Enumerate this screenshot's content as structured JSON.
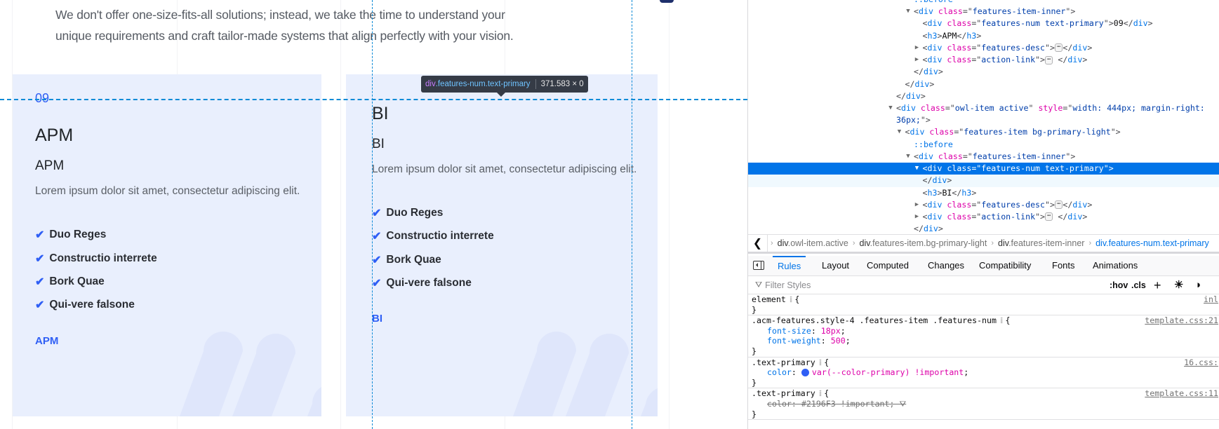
{
  "page": {
    "intro_lines": [
      "We don't offer one-size-fits-all solutions; instead, we take the time to understand your",
      "unique requirements and craft tailor-made systems that align perfectly with your vision."
    ],
    "cards": [
      {
        "num": "09",
        "title": "APM",
        "subtitle": "APM",
        "desc": "Lorem ipsum dolor sit amet, consectetur adipiscing elit.",
        "features": [
          "Duo Reges",
          "Constructio interrete",
          "Bork Quae",
          "Qui-vere falsone"
        ],
        "link": "APM"
      },
      {
        "num": "",
        "title": "BI",
        "subtitle": "BI",
        "desc": "Lorem ipsum dolor sit amet, consectetur adipiscing elit.",
        "features": [
          "Duo Reges",
          "Constructio interrete",
          "Bork Quae",
          "Qui-vere falsone"
        ],
        "link": "BI"
      }
    ],
    "tooltip": {
      "tag": "div",
      "classes": ".features-num.text-primary",
      "size": "371.583 × 0"
    },
    "colors": {
      "primary": "#2f5ff5",
      "card_bg": "#e9effd"
    }
  },
  "devtools": {
    "tree": [
      {
        "depth": 2,
        "arrow": "",
        "parts": [
          [
            "pseudo",
            "::before"
          ]
        ]
      },
      {
        "depth": 2,
        "arrow": "down",
        "parts": [
          [
            "punct",
            "<"
          ],
          [
            "tag",
            "div "
          ],
          [
            "attr",
            "class"
          ],
          [
            "punct",
            "=\""
          ],
          [
            "val",
            "features-item-inner"
          ],
          [
            "punct",
            "\">"
          ]
        ]
      },
      {
        "depth": 3,
        "arrow": "",
        "parts": [
          [
            "punct",
            "<"
          ],
          [
            "tag",
            "div "
          ],
          [
            "attr",
            "class"
          ],
          [
            "punct",
            "=\""
          ],
          [
            "val",
            "features-num text-primary"
          ],
          [
            "punct",
            "\">"
          ],
          [
            "text",
            "09"
          ],
          [
            "punct",
            "</"
          ],
          [
            "tag",
            "div"
          ],
          [
            "punct",
            ">"
          ]
        ]
      },
      {
        "depth": 3,
        "arrow": "",
        "parts": [
          [
            "punct",
            "<"
          ],
          [
            "tag",
            "h3"
          ],
          [
            "punct",
            ">"
          ],
          [
            "text",
            "APM"
          ],
          [
            "punct",
            "</"
          ],
          [
            "tag",
            "h3"
          ],
          [
            "punct",
            ">"
          ]
        ]
      },
      {
        "depth": 3,
        "arrow": "right",
        "parts": [
          [
            "punct",
            "<"
          ],
          [
            "tag",
            "div "
          ],
          [
            "attr",
            "class"
          ],
          [
            "punct",
            "=\""
          ],
          [
            "val",
            "features-desc"
          ],
          [
            "punct",
            "\">"
          ],
          [
            "ell",
            "⋯"
          ],
          [
            "punct",
            "</"
          ],
          [
            "tag",
            "div"
          ],
          [
            "punct",
            ">"
          ]
        ]
      },
      {
        "depth": 3,
        "arrow": "right",
        "parts": [
          [
            "punct",
            "<"
          ],
          [
            "tag",
            "div "
          ],
          [
            "attr",
            "class"
          ],
          [
            "punct",
            "=\""
          ],
          [
            "val",
            "action-link"
          ],
          [
            "punct",
            "\">"
          ],
          [
            "ell",
            "⋯"
          ],
          [
            "punct",
            " </"
          ],
          [
            "tag",
            "div"
          ],
          [
            "punct",
            ">"
          ]
        ]
      },
      {
        "depth": 2,
        "arrow": "",
        "parts": [
          [
            "punct",
            "</"
          ],
          [
            "tag",
            "div"
          ],
          [
            "punct",
            ">"
          ]
        ]
      },
      {
        "depth": 1,
        "arrow": "",
        "parts": [
          [
            "punct",
            "</"
          ],
          [
            "tag",
            "div"
          ],
          [
            "punct",
            ">"
          ]
        ]
      },
      {
        "depth": 0,
        "arrow": "",
        "parts": [
          [
            "punct",
            "</"
          ],
          [
            "tag",
            "div"
          ],
          [
            "punct",
            ">"
          ]
        ]
      },
      {
        "depth": 0,
        "arrow": "down",
        "parts": [
          [
            "punct",
            "<"
          ],
          [
            "tag",
            "div "
          ],
          [
            "attr",
            "class"
          ],
          [
            "punct",
            "=\""
          ],
          [
            "val",
            "owl-item active"
          ],
          [
            "punct",
            "\" "
          ],
          [
            "attr",
            "style"
          ],
          [
            "punct",
            "=\""
          ],
          [
            "val",
            "width: 444px; margin-right:"
          ]
        ]
      },
      {
        "depth": 0,
        "arrow": "",
        "parts": [
          [
            "val",
            "36px;"
          ],
          [
            "punct",
            "\">"
          ]
        ]
      },
      {
        "depth": 1,
        "arrow": "down",
        "parts": [
          [
            "punct",
            "<"
          ],
          [
            "tag",
            "div "
          ],
          [
            "attr",
            "class"
          ],
          [
            "punct",
            "=\""
          ],
          [
            "val",
            "features-item bg-primary-light"
          ],
          [
            "punct",
            "\">"
          ]
        ]
      },
      {
        "depth": 2,
        "arrow": "",
        "parts": [
          [
            "pseudo",
            "::before"
          ]
        ]
      },
      {
        "depth": 2,
        "arrow": "down",
        "parts": [
          [
            "punct",
            "<"
          ],
          [
            "tag",
            "div "
          ],
          [
            "attr",
            "class"
          ],
          [
            "punct",
            "=\""
          ],
          [
            "val",
            "features-item-inner"
          ],
          [
            "punct",
            "\">"
          ]
        ]
      },
      {
        "depth": 3,
        "arrow": "down",
        "selected": true,
        "parts": [
          [
            "punct",
            "<"
          ],
          [
            "tag",
            "div "
          ],
          [
            "attr",
            "class"
          ],
          [
            "punct",
            "=\""
          ],
          [
            "val",
            "features-num text-primary"
          ],
          [
            "punct",
            "\">"
          ]
        ]
      },
      {
        "depth": 3,
        "arrow": "",
        "hover": true,
        "parts": [
          [
            "punct",
            "</"
          ],
          [
            "tag",
            "div"
          ],
          [
            "punct",
            ">"
          ]
        ]
      },
      {
        "depth": 3,
        "arrow": "",
        "parts": [
          [
            "punct",
            "<"
          ],
          [
            "tag",
            "h3"
          ],
          [
            "punct",
            ">"
          ],
          [
            "text",
            "BI"
          ],
          [
            "punct",
            "</"
          ],
          [
            "tag",
            "h3"
          ],
          [
            "punct",
            ">"
          ]
        ]
      },
      {
        "depth": 3,
        "arrow": "right",
        "parts": [
          [
            "punct",
            "<"
          ],
          [
            "tag",
            "div "
          ],
          [
            "attr",
            "class"
          ],
          [
            "punct",
            "=\""
          ],
          [
            "val",
            "features-desc"
          ],
          [
            "punct",
            "\">"
          ],
          [
            "ell",
            "⋯"
          ],
          [
            "punct",
            "</"
          ],
          [
            "tag",
            "div"
          ],
          [
            "punct",
            ">"
          ]
        ]
      },
      {
        "depth": 3,
        "arrow": "right",
        "parts": [
          [
            "punct",
            "<"
          ],
          [
            "tag",
            "div "
          ],
          [
            "attr",
            "class"
          ],
          [
            "punct",
            "=\""
          ],
          [
            "val",
            "action-link"
          ],
          [
            "punct",
            "\">"
          ],
          [
            "ell",
            "⋯"
          ],
          [
            "punct",
            " </"
          ],
          [
            "tag",
            "div"
          ],
          [
            "punct",
            ">"
          ]
        ]
      },
      {
        "depth": 2,
        "arrow": "",
        "parts": [
          [
            "punct",
            "</"
          ],
          [
            "tag",
            "div"
          ],
          [
            "punct",
            ">"
          ]
        ]
      }
    ],
    "breadcrumbs": [
      {
        "tag": "div",
        "cls": ".owl-item.active"
      },
      {
        "tag": "div",
        "cls": ".features-item.bg-primary-light"
      },
      {
        "tag": "div",
        "cls": ".features-item-inner"
      },
      {
        "tag": "div",
        "cls": ".features-num.text-primary",
        "current": true
      }
    ],
    "tabs": [
      "Rules",
      "Layout",
      "Computed",
      "Changes",
      "Compatibility",
      "Fonts",
      "Animations"
    ],
    "active_tab": "Rules",
    "filter_placeholder": "Filter Styles",
    "filter_tools": {
      "hov": ":hov",
      "cls": ".cls",
      "add": "+"
    },
    "rules": [
      {
        "selector": "element",
        "source": "inl",
        "decls": []
      },
      {
        "selector": ".acm-features.style-4 .features-item .features-num",
        "source": "template.css:21",
        "decls": [
          {
            "prop": "font-size",
            "val": "18px"
          },
          {
            "prop": "font-weight",
            "val": "500"
          }
        ]
      },
      {
        "selector": ".text-primary",
        "source": "16.css:",
        "decls": [
          {
            "prop": "color",
            "val": "var(--color-primary) !important",
            "swatch": "#2f5ff5"
          }
        ]
      },
      {
        "selector": ".text-primary",
        "source": "template.css:11",
        "decls": [
          {
            "prop": "color",
            "val": "#2196F3 !important",
            "struck": true
          }
        ]
      }
    ]
  }
}
